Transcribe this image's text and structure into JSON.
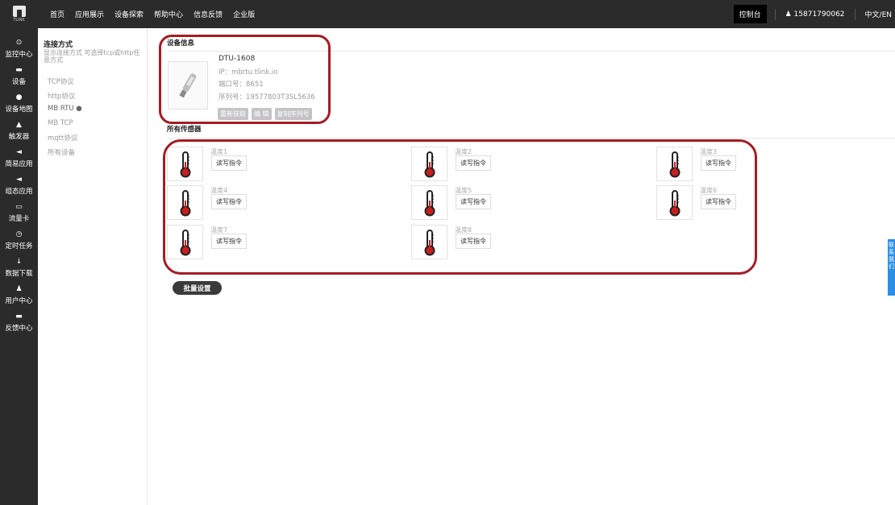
{
  "logo": {
    "text": "TLINK"
  },
  "topnav": [
    "首页",
    "应用展示",
    "设备探索",
    "帮助中心",
    "信息反馈",
    "企业版"
  ],
  "topright": {
    "console": "控制台",
    "phone": "15871790062",
    "lang": "中文/EN"
  },
  "sidebar": [
    {
      "icon": "dashboard-icon",
      "glyph": "⊙",
      "label": "监控中心"
    },
    {
      "icon": "device-icon",
      "glyph": "▬",
      "label": "设备"
    },
    {
      "icon": "map-pin-icon",
      "glyph": "●",
      "label": "设备地图"
    },
    {
      "icon": "bell-icon",
      "glyph": "▲",
      "label": "触发器"
    },
    {
      "icon": "send-icon",
      "glyph": "◄",
      "label": "简易应用"
    },
    {
      "icon": "share-icon",
      "glyph": "◄",
      "label": "组态应用"
    },
    {
      "icon": "card-icon",
      "glyph": "▭",
      "label": "流量卡"
    },
    {
      "icon": "clock-icon",
      "glyph": "◷",
      "label": "定时任务"
    },
    {
      "icon": "download-icon",
      "glyph": "↓",
      "label": "数据下载"
    },
    {
      "icon": "user-icon",
      "glyph": "♟",
      "label": "用户中心"
    },
    {
      "icon": "chat-icon",
      "glyph": "▬",
      "label": "反馈中心"
    }
  ],
  "connection": {
    "title": "连接方式",
    "desc": "显示连接方式 可选择tcp或http任意方式",
    "items": [
      "TCP协议",
      "http协议",
      "MB RTU ●",
      "MB TCP",
      "mqtt协议",
      "所有设备"
    ]
  },
  "device": {
    "section_title": "设备信息",
    "name": "DTU-1608",
    "ip": "IP：mbrtu.tlink.io",
    "port": "端口号：8651",
    "serial": "序列号：19577803T3SL5636",
    "buttons": [
      "重新获取",
      "编 辑",
      "复制序列号"
    ]
  },
  "sensors": {
    "section_title": "所有传感器",
    "rw_label": "读写指令",
    "items": [
      {
        "name": "温度1"
      },
      {
        "name": "温度2"
      },
      {
        "name": "温度3"
      },
      {
        "name": "温度4"
      },
      {
        "name": "温度5"
      },
      {
        "name": "温度6"
      },
      {
        "name": "温度7"
      },
      {
        "name": "温度8"
      }
    ]
  },
  "batch_button": "批量设置",
  "float_tab": [
    "联",
    "系",
    "我",
    "们"
  ],
  "colors": {
    "topbar": "#2b2b2b",
    "highlight": "#a51c24",
    "float_tab": "#2e8ee6"
  }
}
